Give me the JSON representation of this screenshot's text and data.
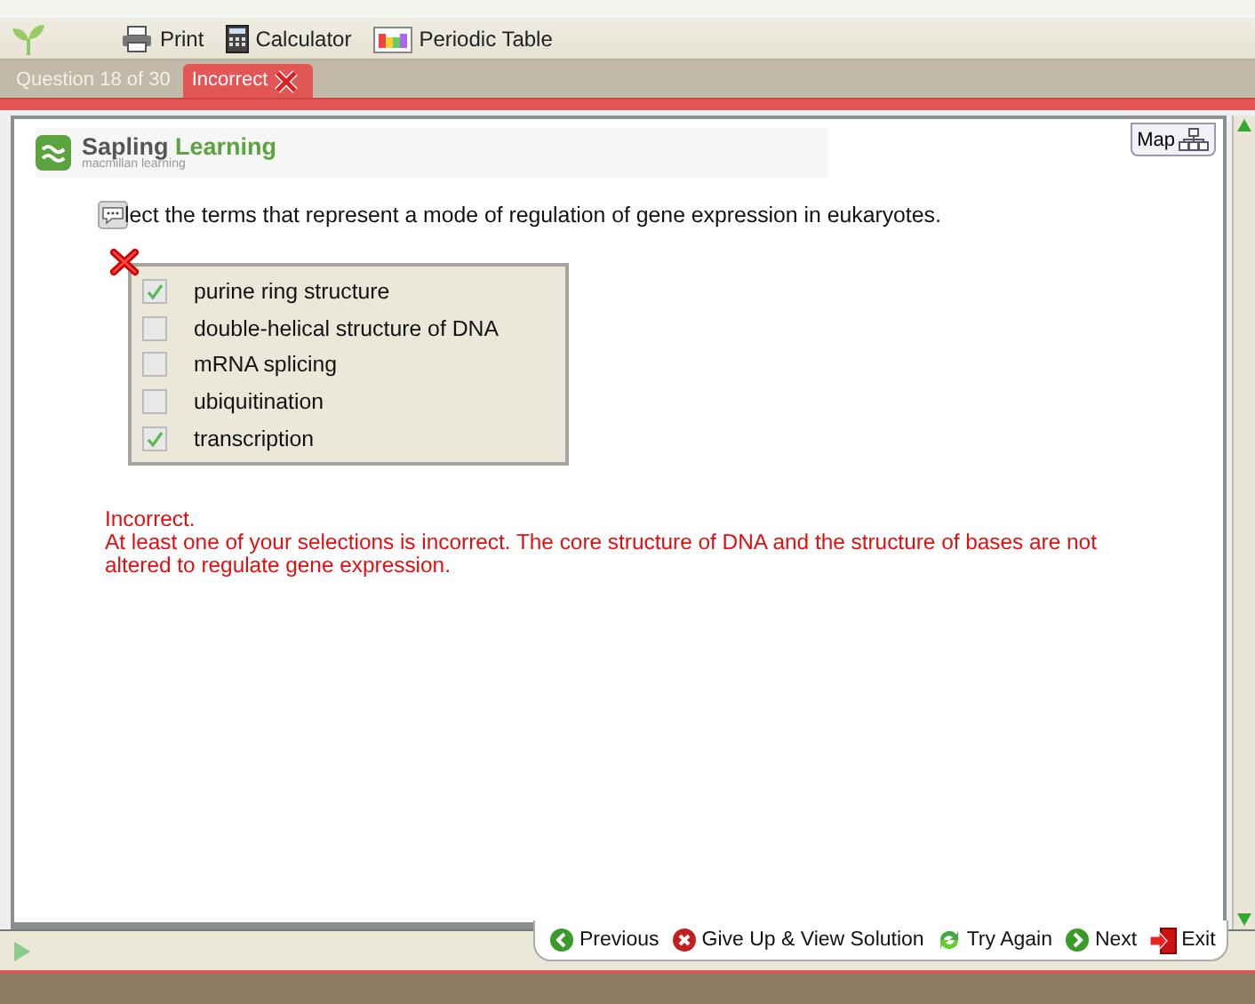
{
  "toolbar": {
    "items": [
      {
        "label": "Print",
        "kind": "print"
      },
      {
        "label": "Calculator",
        "kind": "calculator"
      },
      {
        "label": "Periodic Table",
        "kind": "periodic"
      }
    ]
  },
  "tabs": [
    {
      "label": "Question 18 of 30",
      "selected": false
    },
    {
      "label": "Incorrect",
      "selected": true
    }
  ],
  "brand": {
    "name": "Sapling",
    "accent": "Learning",
    "tagline": "macmillan learning"
  },
  "map_button": {
    "label": "Map"
  },
  "question": "lect the terms that represent a mode of regulation of gene expression in eukaryotes.",
  "answer": {
    "correct": false
  },
  "choices": [
    {
      "label": "purine ring structure",
      "checked": true
    },
    {
      "label": "double-helical structure of DNA",
      "checked": false
    },
    {
      "label": "mRNA splicing",
      "checked": false
    },
    {
      "label": "ubiquitination",
      "checked": false
    },
    {
      "label": "transcription",
      "checked": true
    }
  ],
  "feedback": {
    "title": "Incorrect.",
    "message": "At least one of your selections is incorrect. The core structure of DNA and the structure of bases are not altered to regulate gene expression."
  },
  "nav": [
    {
      "label": "Previous",
      "kind": "previous"
    },
    {
      "label": "Give Up & View Solution",
      "kind": "giveup"
    },
    {
      "label": "Try Again",
      "kind": "retry"
    },
    {
      "label": "Next",
      "kind": "next"
    },
    {
      "label": "Exit",
      "kind": "exit"
    }
  ]
}
